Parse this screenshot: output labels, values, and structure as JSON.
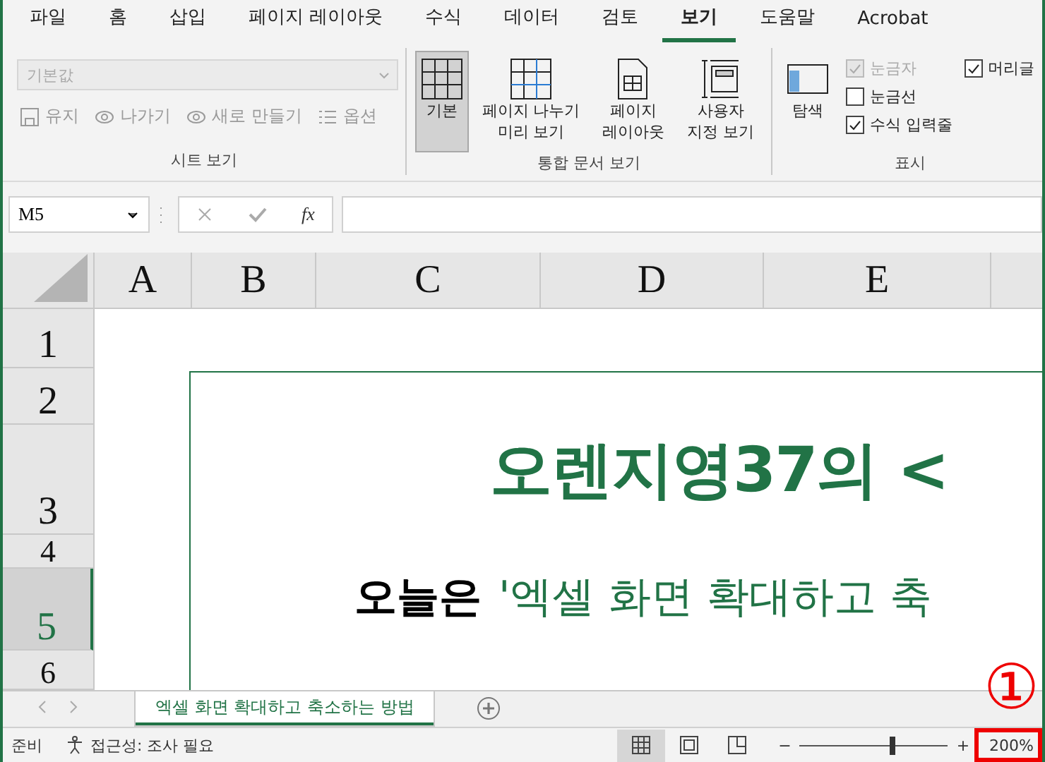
{
  "menu_tabs": [
    {
      "label": "파일",
      "selected": false
    },
    {
      "label": "홈",
      "selected": false
    },
    {
      "label": "삽입",
      "selected": false
    },
    {
      "label": "페이지 레이아웃",
      "selected": false
    },
    {
      "label": "수식",
      "selected": false
    },
    {
      "label": "데이터",
      "selected": false
    },
    {
      "label": "검토",
      "selected": false
    },
    {
      "label": "보기",
      "selected": true
    },
    {
      "label": "도움말",
      "selected": false
    },
    {
      "label": "Acrobat",
      "selected": false
    }
  ],
  "ribbon": {
    "sheet_view": {
      "dropdown_value": "기본값",
      "buttons": [
        {
          "label": "유지",
          "kind": "keep"
        },
        {
          "label": "나가기",
          "kind": "exit"
        },
        {
          "label": "새로 만들기",
          "kind": "new"
        },
        {
          "label": "옵션",
          "kind": "options"
        }
      ],
      "group_label": "시트 보기"
    },
    "workbook_views": {
      "buttons": [
        {
          "label": "기본",
          "kind": "normal",
          "selected": true
        },
        {
          "label": "페이지 나누기 미리 보기",
          "kind": "pagebreak",
          "selected": false
        },
        {
          "label": "페이지 레이아웃",
          "kind": "layout",
          "selected": false
        },
        {
          "label": "사용자 지정 보기",
          "kind": "custom",
          "selected": false
        }
      ],
      "group_label": "통합 문서 보기"
    },
    "show": {
      "navigation_label": "탐색",
      "checkboxes": [
        {
          "label": "눈금자",
          "checked": true,
          "disabled": true
        },
        {
          "label": "눈금선",
          "checked": false,
          "disabled": false
        },
        {
          "label": "수식 입력줄",
          "checked": true,
          "disabled": false
        }
      ],
      "extra_checkbox": {
        "label": "머리글",
        "checked": true
      },
      "group_label": "표시"
    }
  },
  "formula_bar": {
    "name_box": "M5",
    "fx_label": "fx"
  },
  "columns": [
    {
      "label": "A",
      "selected": false
    },
    {
      "label": "B",
      "selected": false
    },
    {
      "label": "C",
      "selected": false
    },
    {
      "label": "D",
      "selected": false
    },
    {
      "label": "E",
      "selected": false
    }
  ],
  "rows": [
    {
      "label": "1",
      "selected": false
    },
    {
      "label": "2",
      "selected": false
    },
    {
      "label": "3",
      "selected": false
    },
    {
      "label": "4",
      "selected": false
    },
    {
      "label": "5",
      "selected": true
    },
    {
      "label": "6",
      "selected": false
    }
  ],
  "sheet_content": {
    "title": "오렌지영37의 <",
    "subtitle_lead": "오늘은",
    "subtitle_quote": "'엑셀 화면 확대하고 축"
  },
  "sheet_tabs": [
    {
      "label": "엑셀 화면 확대하고 축소하는 방법",
      "selected": true
    }
  ],
  "status_bar": {
    "ready": "준비",
    "accessibility": "접근성: 조사 필요",
    "views": [
      {
        "kind": "normal",
        "selected": true
      },
      {
        "kind": "layout",
        "selected": false
      },
      {
        "kind": "pagebreak",
        "selected": false
      }
    ],
    "zoom": {
      "minus": "−",
      "plus": "+",
      "level": 0.63,
      "percent": "200%"
    }
  },
  "annotation": {
    "marker": "①"
  }
}
